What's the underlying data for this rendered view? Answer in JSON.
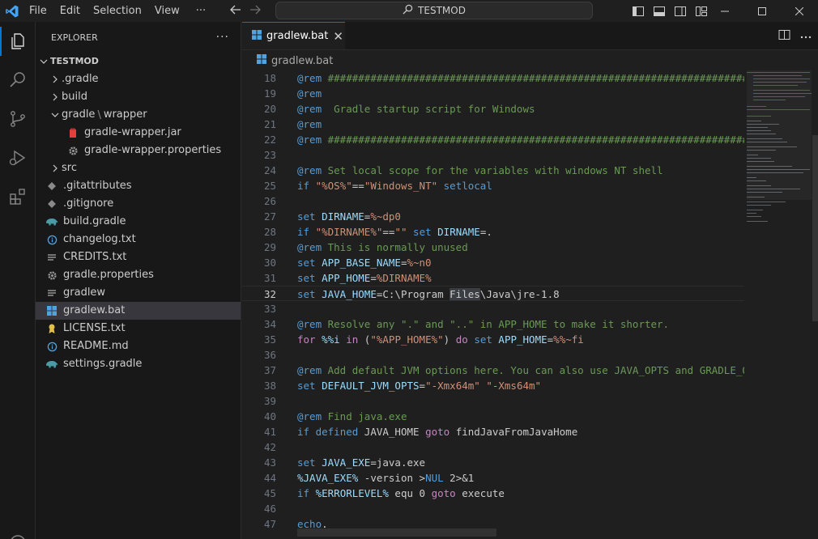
{
  "titlebar": {
    "menu": [
      "File",
      "Edit",
      "Selection",
      "View"
    ],
    "more": "···",
    "search_text": "TESTMOD"
  },
  "sidebar": {
    "title": "EXPLORER",
    "more": "···",
    "root": "TESTMOD",
    "items": [
      {
        "label": ".gradle",
        "type": "folder",
        "depth": 1
      },
      {
        "label": "build",
        "type": "folder",
        "depth": 1
      },
      {
        "label": "gradle",
        "label2": "wrapper",
        "type": "folder-open",
        "depth": 1
      },
      {
        "label": "gradle-wrapper.jar",
        "type": "jar",
        "depth": 2
      },
      {
        "label": "gradle-wrapper.properties",
        "type": "gear",
        "depth": 2
      },
      {
        "label": "src",
        "type": "folder",
        "depth": 1
      },
      {
        "label": ".gitattributes",
        "type": "git",
        "depth": 1
      },
      {
        "label": ".gitignore",
        "type": "git",
        "depth": 1
      },
      {
        "label": "build.gradle",
        "type": "gradle",
        "depth": 1
      },
      {
        "label": "changelog.txt",
        "type": "info",
        "depth": 1
      },
      {
        "label": "CREDITS.txt",
        "type": "lines",
        "depth": 1
      },
      {
        "label": "gradle.properties",
        "type": "gear",
        "depth": 1
      },
      {
        "label": "gradlew",
        "type": "lines",
        "depth": 1
      },
      {
        "label": "gradlew.bat",
        "type": "windows",
        "depth": 1,
        "selected": true
      },
      {
        "label": "LICENSE.txt",
        "type": "license",
        "depth": 1
      },
      {
        "label": "README.md",
        "type": "info",
        "depth": 1
      },
      {
        "label": "settings.gradle",
        "type": "gradle",
        "depth": 1
      }
    ]
  },
  "editor": {
    "tab_label": "gradlew.bat",
    "tab_close": "✕",
    "breadcrumb": "gradlew.bat",
    "current_line": 32,
    "lines": [
      {
        "n": "18",
        "parts": [
          [
            "kw",
            "@rem"
          ],
          [
            "cm",
            " ##########################################################################"
          ]
        ]
      },
      {
        "n": "19",
        "parts": [
          [
            "kw",
            "@rem"
          ]
        ]
      },
      {
        "n": "20",
        "parts": [
          [
            "kw",
            "@rem"
          ],
          [
            "cm",
            "  Gradle startup script for Windows"
          ]
        ]
      },
      {
        "n": "21",
        "parts": [
          [
            "kw",
            "@rem"
          ]
        ]
      },
      {
        "n": "22",
        "parts": [
          [
            "kw",
            "@rem"
          ],
          [
            "cm",
            " ##########################################################################"
          ]
        ]
      },
      {
        "n": "23",
        "parts": []
      },
      {
        "n": "24",
        "parts": [
          [
            "kw",
            "@rem"
          ],
          [
            "cm",
            " Set local scope for the variables with windows NT shell"
          ]
        ]
      },
      {
        "n": "25",
        "parts": [
          [
            "kw",
            "if"
          ],
          [
            "pl",
            " "
          ],
          [
            "str",
            "\"%OS%\""
          ],
          [
            "pl",
            "=="
          ],
          [
            "str",
            "\"Windows_NT\""
          ],
          [
            "pl",
            " "
          ],
          [
            "kw",
            "setlocal"
          ]
        ]
      },
      {
        "n": "26",
        "parts": []
      },
      {
        "n": "27",
        "parts": [
          [
            "kw",
            "set"
          ],
          [
            "pl",
            " "
          ],
          [
            "var",
            "DIRNAME"
          ],
          [
            "pl",
            "="
          ],
          [
            "str",
            "%~dp0"
          ]
        ]
      },
      {
        "n": "28",
        "parts": [
          [
            "kw",
            "if"
          ],
          [
            "pl",
            " "
          ],
          [
            "str",
            "\"%DIRNAME%\""
          ],
          [
            "pl",
            "=="
          ],
          [
            "str",
            "\"\""
          ],
          [
            "pl",
            " "
          ],
          [
            "kw",
            "set"
          ],
          [
            "pl",
            " "
          ],
          [
            "var",
            "DIRNAME"
          ],
          [
            "pl",
            "=."
          ]
        ]
      },
      {
        "n": "29",
        "parts": [
          [
            "kw",
            "@rem"
          ],
          [
            "cm",
            " This is normally unused"
          ]
        ]
      },
      {
        "n": "30",
        "parts": [
          [
            "kw",
            "set"
          ],
          [
            "pl",
            " "
          ],
          [
            "var",
            "APP_BASE_NAME"
          ],
          [
            "pl",
            "="
          ],
          [
            "str",
            "%~n0"
          ]
        ]
      },
      {
        "n": "31",
        "parts": [
          [
            "kw",
            "set"
          ],
          [
            "pl",
            " "
          ],
          [
            "var",
            "APP_HOME"
          ],
          [
            "pl",
            "="
          ],
          [
            "str",
            "%DIRNAME%"
          ]
        ]
      },
      {
        "n": "32",
        "parts": [
          [
            "kw",
            "set"
          ],
          [
            "pl",
            " "
          ],
          [
            "var",
            "JAVA_HOME"
          ],
          [
            "pl",
            "=C:\\Program "
          ],
          [
            "hl",
            "Files"
          ],
          [
            "pl",
            "\\Java\\jre-1.8"
          ]
        ]
      },
      {
        "n": "33",
        "parts": []
      },
      {
        "n": "34",
        "parts": [
          [
            "kw",
            "@rem"
          ],
          [
            "cm",
            " Resolve any \".\" and \"..\" in APP_HOME to make it shorter."
          ]
        ]
      },
      {
        "n": "35",
        "parts": [
          [
            "ctl",
            "for"
          ],
          [
            "pl",
            " "
          ],
          [
            "var",
            "%%i"
          ],
          [
            "pl",
            " "
          ],
          [
            "ctl",
            "in"
          ],
          [
            "pl",
            " ("
          ],
          [
            "str",
            "\"%APP_HOME%\""
          ],
          [
            "pl",
            ") "
          ],
          [
            "ctl",
            "do"
          ],
          [
            "pl",
            " "
          ],
          [
            "kw",
            "set"
          ],
          [
            "pl",
            " "
          ],
          [
            "var",
            "APP_HOME"
          ],
          [
            "pl",
            "="
          ],
          [
            "str",
            "%%~fi"
          ]
        ]
      },
      {
        "n": "36",
        "parts": []
      },
      {
        "n": "37",
        "parts": [
          [
            "kw",
            "@rem"
          ],
          [
            "cm",
            " Add default JVM options here. You can also use JAVA_OPTS and GRADLE_OPTS"
          ]
        ]
      },
      {
        "n": "38",
        "parts": [
          [
            "kw",
            "set"
          ],
          [
            "pl",
            " "
          ],
          [
            "var",
            "DEFAULT_JVM_OPTS"
          ],
          [
            "pl",
            "="
          ],
          [
            "str",
            "\"-Xmx64m\""
          ],
          [
            "pl",
            " "
          ],
          [
            "str",
            "\"-Xms64m\""
          ]
        ]
      },
      {
        "n": "39",
        "parts": []
      },
      {
        "n": "40",
        "parts": [
          [
            "kw",
            "@rem"
          ],
          [
            "cm",
            " Find java.exe"
          ]
        ]
      },
      {
        "n": "41",
        "parts": [
          [
            "kw",
            "if"
          ],
          [
            "pl",
            " "
          ],
          [
            "kw",
            "defined"
          ],
          [
            "pl",
            " JAVA_HOME "
          ],
          [
            "ctl",
            "goto"
          ],
          [
            "pl",
            " findJavaFromJavaHome"
          ]
        ]
      },
      {
        "n": "42",
        "parts": []
      },
      {
        "n": "43",
        "parts": [
          [
            "kw",
            "set"
          ],
          [
            "pl",
            " "
          ],
          [
            "var",
            "JAVA_EXE"
          ],
          [
            "pl",
            "=java.exe"
          ]
        ]
      },
      {
        "n": "44",
        "parts": [
          [
            "var",
            "%JAVA_EXE%"
          ],
          [
            "pl",
            " -version >"
          ],
          [
            "kw",
            "NUL"
          ],
          [
            "pl",
            " 2>&1"
          ]
        ]
      },
      {
        "n": "45",
        "parts": [
          [
            "kw",
            "if"
          ],
          [
            "pl",
            " "
          ],
          [
            "var",
            "%ERRORLEVEL%"
          ],
          [
            "pl",
            " equ 0 "
          ],
          [
            "ctl",
            "goto"
          ],
          [
            "pl",
            " execute"
          ]
        ]
      },
      {
        "n": "46",
        "parts": []
      },
      {
        "n": "47",
        "parts": [
          [
            "kw",
            "echo"
          ],
          [
            "pl",
            "."
          ]
        ]
      }
    ]
  }
}
